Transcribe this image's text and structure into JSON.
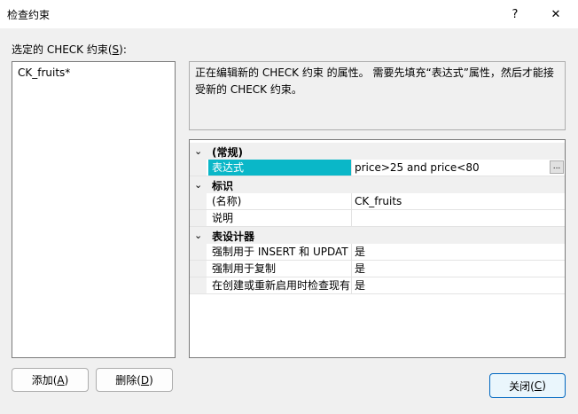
{
  "window": {
    "title": "检查约束",
    "help": "?",
    "close": "✕"
  },
  "left": {
    "label_prefix": "选定的 CHECK 约束(",
    "label_key": "S",
    "label_suffix": "):",
    "items": [
      "CK_fruits*"
    ]
  },
  "description": "正在编辑新的 CHECK 约束 的属性。  需要先填充“表达式”属性，然后才能接受新的 CHECK 约束。",
  "grid": {
    "categories": [
      {
        "title": "(常规)",
        "rows": [
          {
            "name": "表达式",
            "value": "price>25 and price<80"
          }
        ]
      },
      {
        "title": "标识",
        "rows": [
          {
            "name": "(名称)",
            "value": "CK_fruits"
          },
          {
            "name": "说明",
            "value": ""
          }
        ]
      },
      {
        "title": "表设计器",
        "rows": [
          {
            "name": "强制用于 INSERT 和 UPDAT",
            "value": "是"
          },
          {
            "name": "强制用于复制",
            "value": "是"
          },
          {
            "name": "在创建或重新启用时检查现有",
            "value": "是"
          }
        ]
      }
    ],
    "ellipsis": "..."
  },
  "buttons": {
    "add": {
      "text": "添加(",
      "key": "A",
      "suffix": ")"
    },
    "delete": {
      "text": "删除(",
      "key": "D",
      "suffix": ")"
    },
    "close": {
      "text": "关闭(",
      "key": "C",
      "suffix": ")"
    }
  },
  "icons": {
    "chevron": "chevron-down-icon"
  },
  "colors": {
    "selection": "#0ab7c8",
    "default_button_border": "#0067c0"
  }
}
